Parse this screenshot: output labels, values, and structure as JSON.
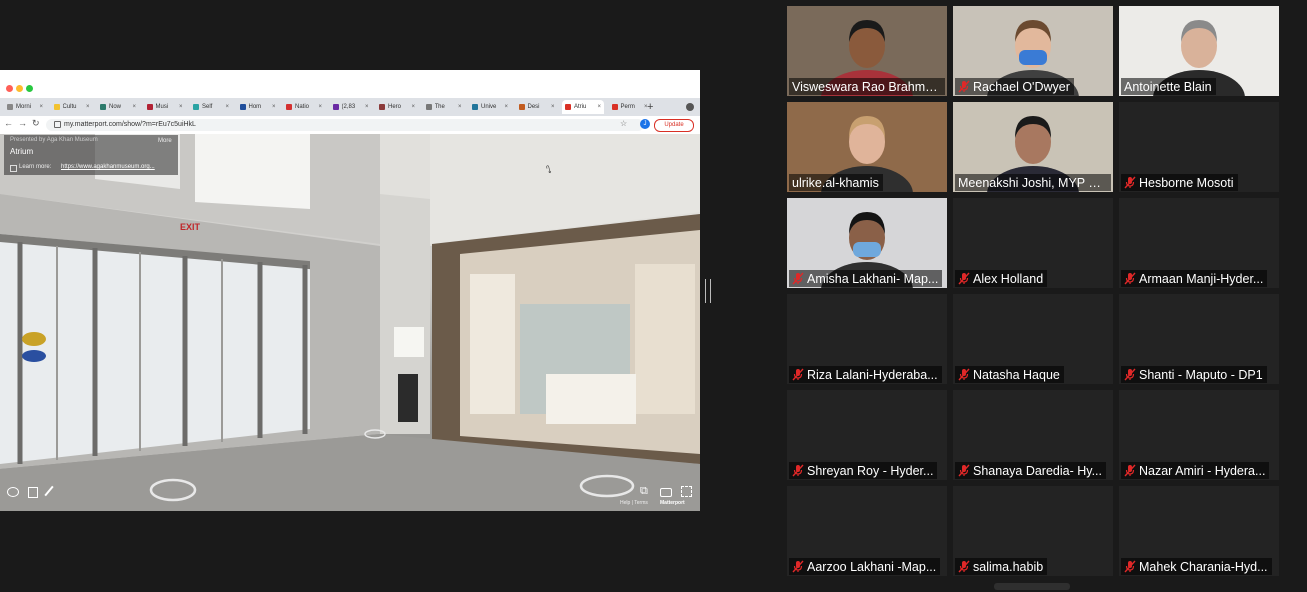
{
  "browser": {
    "tabs": [
      {
        "label": "Morni",
        "color": "#888888"
      },
      {
        "label": "Cultu",
        "color": "#f2c230"
      },
      {
        "label": "Now",
        "color": "#2c7a6b"
      },
      {
        "label": "Musi",
        "color": "#b22234"
      },
      {
        "label": "Self",
        "color": "#2aa3a3"
      },
      {
        "label": "Hom",
        "color": "#1f4e9c"
      },
      {
        "label": "Natio",
        "color": "#d43030"
      },
      {
        "label": "(2,83",
        "color": "#6a2aa3"
      },
      {
        "label": "Hero",
        "color": "#8b3a3a"
      },
      {
        "label": "The",
        "color": "#777777"
      },
      {
        "label": "Unive",
        "color": "#21759b"
      },
      {
        "label": "Desi",
        "color": "#c25b1f"
      },
      {
        "label": "Atriu",
        "color": "#d93025"
      },
      {
        "label": "Perm",
        "color": "#d93025"
      }
    ],
    "active_tab_index": 12,
    "new_tab_glyph": "+",
    "url": "my.matterport.com/show/?m=rEu7c5uiHkL",
    "update_label": "Update",
    "profile_initial": "J"
  },
  "matterport": {
    "presented_by": "Presented by Aga Khan Museum",
    "more_label": "More",
    "space_title": "Atrium",
    "learn_more_label": "Learn more:",
    "learn_more_link": "https://www.agakhanmuseum.org...",
    "footer_links": "Help | Terms",
    "brand": "Matterport",
    "exit_sign": "EXIT"
  },
  "participants": [
    {
      "name": "Visweswara Rao Brahma...",
      "muted": false,
      "video": true,
      "active": false
    },
    {
      "name": "Rachael O'Dwyer",
      "muted": true,
      "video": true,
      "active": false
    },
    {
      "name": "Antoinette Blain",
      "muted": false,
      "video": true,
      "active": false
    },
    {
      "name": "ulrike.al-khamis",
      "muted": false,
      "video": true,
      "active": false
    },
    {
      "name": "Meenakshi Joshi, MYP C...",
      "muted": false,
      "video": true,
      "active": true
    },
    {
      "name": "Hesborne Mosoti",
      "muted": true,
      "video": false,
      "active": false
    },
    {
      "name": "Amisha Lakhani- Map...",
      "muted": true,
      "video": true,
      "active": false
    },
    {
      "name": "Alex Holland",
      "muted": true,
      "video": false,
      "active": false
    },
    {
      "name": "Armaan Manji-Hyder...",
      "muted": true,
      "video": false,
      "active": false
    },
    {
      "name": "Riza Lalani-Hyderaba...",
      "muted": true,
      "video": false,
      "active": false
    },
    {
      "name": "Natasha Haque",
      "muted": true,
      "video": false,
      "active": false
    },
    {
      "name": "Shanti - Maputo - DP1",
      "muted": true,
      "video": false,
      "active": false
    },
    {
      "name": "Shreyan Roy - Hyder...",
      "muted": true,
      "video": false,
      "active": false
    },
    {
      "name": "Shanaya Daredia- Hy...",
      "muted": true,
      "video": false,
      "active": false
    },
    {
      "name": "Nazar Amiri - Hydera...",
      "muted": true,
      "video": false,
      "active": false
    },
    {
      "name": "Aarzoo Lakhani -Map...",
      "muted": true,
      "video": false,
      "active": false
    },
    {
      "name": "salima.habib",
      "muted": true,
      "video": false,
      "active": false
    },
    {
      "name": "Mahek Charania-Hyd...",
      "muted": true,
      "video": false,
      "active": false
    }
  ],
  "colors": {
    "background": "#1a1a1a",
    "tile": "#232323",
    "active_speaker": "#d4f06b",
    "mic_off": "#e02828"
  }
}
